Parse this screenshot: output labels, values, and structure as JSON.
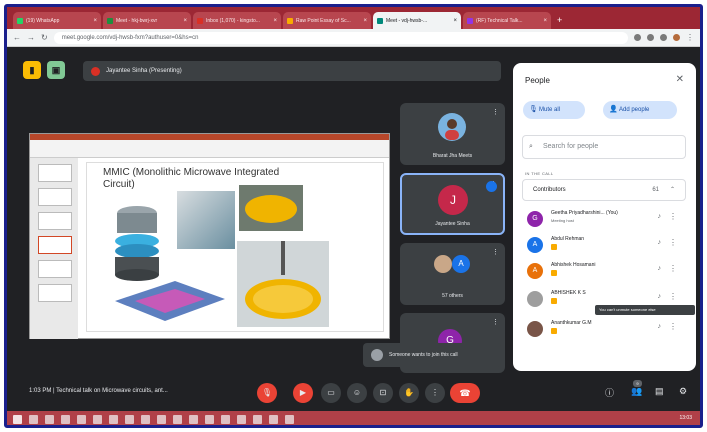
{
  "browser": {
    "tabs": [
      {
        "label": "(19) WhatsApp",
        "color": "#25d366",
        "active": false
      },
      {
        "label": "Meet - hkj-bwrj-xvr",
        "color": "#1e8e3e",
        "active": false
      },
      {
        "label": "Inbox (1,070) - kingsto...",
        "color": "#d93025",
        "active": false
      },
      {
        "label": "Raw Point Essay of Sc...",
        "color": "#f9ab00",
        "active": false
      },
      {
        "label": "Meet - vdj-hwsb-...",
        "color": "#00897b",
        "active": true
      },
      {
        "label": "(RF) Technical Talk...",
        "color": "#9334e6",
        "active": false
      }
    ],
    "url": "meet.google.com/vdj-hwsb-fxm?authuser=0&hs=cn"
  },
  "meet": {
    "presenting_label": "Jayantee Sinha (Presenting)",
    "slide": {
      "title": "MMIC (Monolithic Microwave Integrated Circuit)"
    },
    "tiles": [
      {
        "name": "Bharat Jha Meets"
      },
      {
        "name": "Jayantee Sinha",
        "initial": "J"
      },
      {
        "name": "57 others",
        "initial": "A"
      },
      {
        "name": "",
        "initial": "G"
      }
    ],
    "toast": "Someone wants to join this call",
    "meeting_info": "1:03 PM  |  Technical talk on Microwave circuits, ant...",
    "participant_count_badge": "9"
  },
  "people": {
    "title": "People",
    "mute_all": "Mute all",
    "add_people": "Add people",
    "search_placeholder": "Search for people",
    "in_call_label": "IN THE CALL",
    "contributors": {
      "label": "Contributors",
      "count": "61"
    },
    "list": [
      {
        "name": "Geetha Priyadharshini... (You)",
        "sub": "Meeting host",
        "initial": "G",
        "color": "#8e24aa"
      },
      {
        "name": "Abdul Rehman",
        "sub": "",
        "initial": "A",
        "color": "#1a73e8"
      },
      {
        "name": "Abhishek Hosamani",
        "sub": "",
        "initial": "A",
        "color": "#e8710a"
      },
      {
        "name": "ABHISHEK K S",
        "sub": "",
        "initial": "",
        "color": "#9e9e9e"
      },
      {
        "name": "Ananthkumar G.M",
        "sub": "",
        "initial": "",
        "color": "#795548"
      }
    ],
    "tooltip": "You can't unmute someone else"
  },
  "taskbar": {
    "time": "13:03"
  }
}
